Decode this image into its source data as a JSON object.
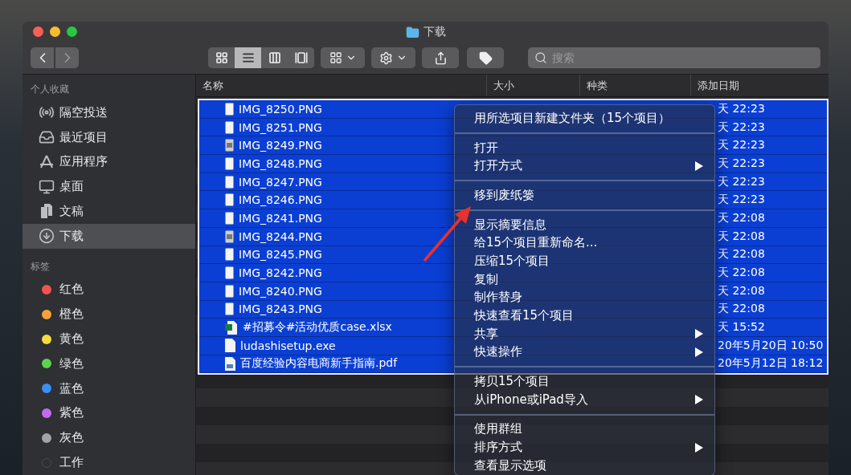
{
  "window": {
    "title": "下载"
  },
  "toolbar": {
    "views": [
      {
        "kind": "icons",
        "selected": false
      },
      {
        "kind": "list",
        "selected": true
      },
      {
        "kind": "columns",
        "selected": false
      },
      {
        "kind": "gallery",
        "selected": false
      }
    ],
    "search": {
      "placeholder": "搜索"
    }
  },
  "sidebar": {
    "favorites_heading": "个人收藏",
    "favorites": [
      {
        "label": "隔空投送",
        "kind": "airdrop",
        "selected": false
      },
      {
        "label": "最近项目",
        "kind": "recents",
        "selected": false
      },
      {
        "label": "应用程序",
        "kind": "apps",
        "selected": false
      },
      {
        "label": "桌面",
        "kind": "desktop",
        "selected": false
      },
      {
        "label": "文稿",
        "kind": "documents",
        "selected": false
      },
      {
        "label": "下载",
        "kind": "downloads",
        "selected": true
      }
    ],
    "tags_heading": "标签",
    "tags": [
      {
        "label": "红色",
        "color": "#f2534f"
      },
      {
        "label": "橙色",
        "color": "#f7a33a"
      },
      {
        "label": "黄色",
        "color": "#f6dc3b"
      },
      {
        "label": "绿色",
        "color": "#5ad54c"
      },
      {
        "label": "蓝色",
        "color": "#3a8ef6"
      },
      {
        "label": "紫色",
        "color": "#c46af0"
      },
      {
        "label": "灰色",
        "color": "#a3a3a6"
      },
      {
        "label": "工作",
        "color": "#4a4a4d"
      }
    ]
  },
  "table": {
    "columns": [
      "名称",
      "大小",
      "种类",
      "添加日期"
    ],
    "rows": [
      {
        "name": "IMG_8250.PNG",
        "kind": "image",
        "date": "天 22:23",
        "selected": true
      },
      {
        "name": "IMG_8251.PNG",
        "kind": "image",
        "date": "天 22:23",
        "selected": true
      },
      {
        "name": "IMG_8249.PNG",
        "kind": "photo",
        "date": "天 22:23",
        "selected": true
      },
      {
        "name": "IMG_8248.PNG",
        "kind": "image",
        "date": "天 22:23",
        "selected": true
      },
      {
        "name": "IMG_8247.PNG",
        "kind": "image",
        "date": "天 22:23",
        "selected": true
      },
      {
        "name": "IMG_8246.PNG",
        "kind": "image",
        "date": "天 22:23",
        "selected": true
      },
      {
        "name": "IMG_8241.PNG",
        "kind": "image",
        "date": "天 22:08",
        "selected": true
      },
      {
        "name": "IMG_8244.PNG",
        "kind": "photo",
        "date": "天 22:08",
        "selected": true
      },
      {
        "name": "IMG_8245.PNG",
        "kind": "image",
        "date": "天 22:08",
        "selected": true
      },
      {
        "name": "IMG_8242.PNG",
        "kind": "image",
        "date": "天 22:08",
        "selected": true
      },
      {
        "name": "IMG_8240.PNG",
        "kind": "image",
        "date": "天 22:08",
        "selected": true
      },
      {
        "name": "IMG_8243.PNG",
        "kind": "image",
        "date": "天 22:08",
        "selected": true
      },
      {
        "name": "#招募令#活动优质case.xlsx",
        "kind": "spreadsheet",
        "date": "天 15:52",
        "selected": true
      },
      {
        "name": "ludashisetup.exe",
        "kind": "file",
        "date": "20年5月20日 10:50",
        "selected": true
      },
      {
        "name": "百度经验内容电商新手指南.pdf",
        "kind": "pdf",
        "date": "20年5月12日 18:12",
        "selected": true
      }
    ]
  },
  "context_menu": {
    "groups": [
      [
        {
          "label": "用所选项目新建文件夹（15个项目）",
          "submenu": false
        }
      ],
      [
        {
          "label": "打开",
          "submenu": false
        },
        {
          "label": "打开方式",
          "submenu": true
        }
      ],
      [
        {
          "label": "移到废纸篓",
          "submenu": false
        }
      ],
      [
        {
          "label": "显示摘要信息",
          "submenu": false
        },
        {
          "label": "给15个项目重新命名...",
          "submenu": false
        },
        {
          "label": "压缩15个项目",
          "submenu": false
        },
        {
          "label": "复制",
          "submenu": false
        },
        {
          "label": "制作替身",
          "submenu": false
        },
        {
          "label": "快速查看15个项目",
          "submenu": false
        },
        {
          "label": "共享",
          "submenu": true
        },
        {
          "label": "快速操作",
          "submenu": true
        }
      ],
      [
        {
          "label": "拷贝15个项目",
          "submenu": false
        },
        {
          "label": "从iPhone或iPad导入",
          "submenu": true
        }
      ],
      [
        {
          "label": "使用群组",
          "submenu": false
        },
        {
          "label": "排序方式",
          "submenu": true
        },
        {
          "label": "查看显示选项",
          "submenu": false
        }
      ]
    ]
  }
}
